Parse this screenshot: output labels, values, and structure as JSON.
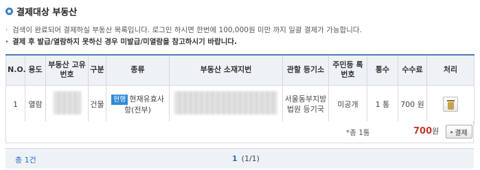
{
  "section_title": "결제대상 부동산",
  "notices": [
    "검색이 완료되어 결제하실 부동산 목록입니다. 로그인 하시면 한번에 100,000원 미만 까지 일괄 결제가 가능합니다.",
    "결제 후 발급/열람하지 못하신 경우 미발급/미열람을 참고하시기 바랍니다."
  ],
  "table": {
    "headers": [
      "N.O.",
      "용도",
      "부동산 고유번호",
      "구분",
      "종류",
      "부동산 소재지번",
      "관할 등기소",
      "주민등 록번호",
      "통수",
      "수수료",
      "처리"
    ],
    "rows": [
      {
        "no": "1",
        "purpose": "열람",
        "unique_no": "",
        "category": "건물",
        "kind_badge": "현행",
        "kind_text": "현재유효사항(전부)",
        "address": "",
        "registry": "서울동부지방법원 등기국",
        "resident_no": "미공개",
        "copies": "1 통",
        "fee": "700 원"
      }
    ]
  },
  "summary": {
    "count_text": "*총 1통",
    "amount": "700",
    "unit": "원",
    "pay_label": "결제"
  },
  "footer": {
    "total": "총 1건",
    "page": "1",
    "page_info": "(1/1)"
  }
}
